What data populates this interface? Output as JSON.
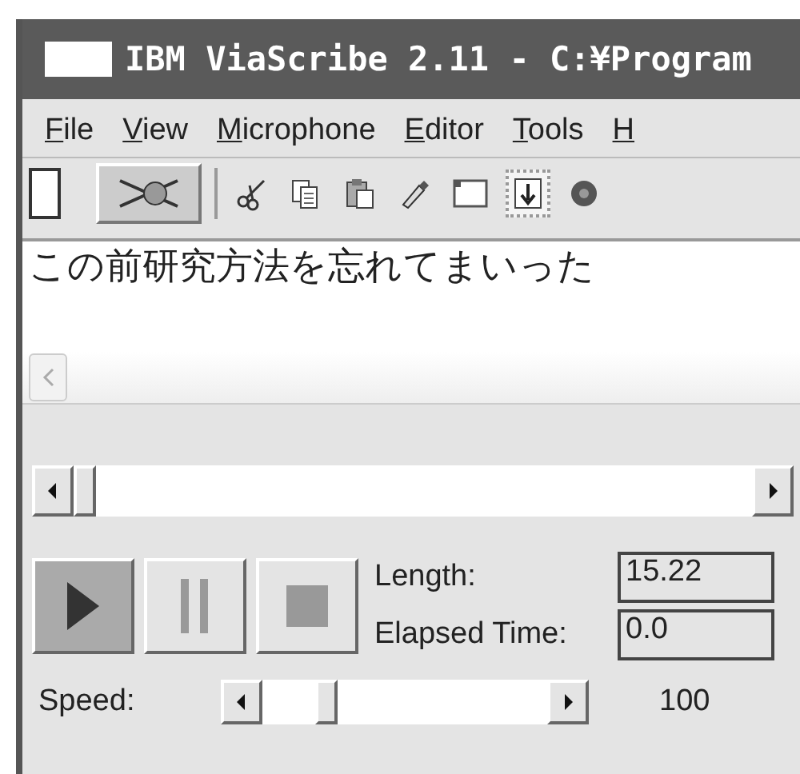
{
  "window": {
    "title": "IBM ViaScribe 2.11 - C:¥Program"
  },
  "menu": [
    {
      "label": "File"
    },
    {
      "label": "View"
    },
    {
      "label": "Microphone"
    },
    {
      "label": "Editor"
    },
    {
      "label": "Tools"
    },
    {
      "label": "H"
    }
  ],
  "toolbar": [
    {
      "kind": "blank",
      "pressed": false
    },
    {
      "kind": "mic-off",
      "pressed": false
    },
    {
      "kind": "cut",
      "pressed": false
    },
    {
      "kind": "copy",
      "pressed": false
    },
    {
      "kind": "paste",
      "pressed": false
    },
    {
      "kind": "pen",
      "pressed": false
    },
    {
      "kind": "window",
      "pressed": false
    },
    {
      "kind": "down",
      "pressed": true
    },
    {
      "kind": "gear",
      "pressed": false
    }
  ],
  "transcript": {
    "text": "この前研究方法を忘れてまいった"
  },
  "position": {
    "level": 0
  },
  "transport": [
    {
      "kind": "play",
      "pressed": true
    },
    {
      "kind": "pause",
      "pressed": false
    },
    {
      "kind": "stop",
      "pressed": false
    }
  ],
  "length": {
    "label": "Length:",
    "value": "15.22"
  },
  "elapsed": {
    "label": "Elapsed Time:",
    "value": "0.0"
  },
  "speed": {
    "label": "Speed:",
    "level": 0.2,
    "reading": "100"
  }
}
